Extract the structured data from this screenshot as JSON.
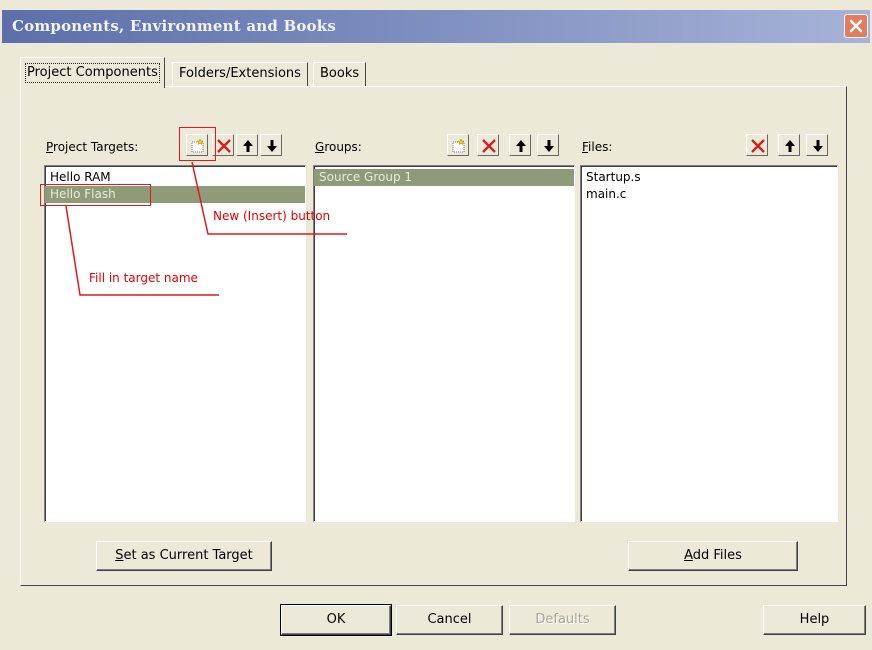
{
  "window": {
    "title": "Components, Environment and Books"
  },
  "tabs": [
    {
      "label": "Project Components",
      "active": true
    },
    {
      "label": "Folders/Extensions",
      "active": false
    },
    {
      "label": "Books",
      "active": false
    }
  ],
  "targets": {
    "label_prefix": "P",
    "label_rest": "roject Targets:",
    "items": [
      "Hello RAM",
      "Hello Flash"
    ],
    "selected": "Hello Flash",
    "buttons": [
      "new-icon",
      "delete-icon",
      "move-up-icon",
      "move-down-icon"
    ]
  },
  "groups": {
    "label_prefix": "G",
    "label_rest": "roups:",
    "items": [
      "Source Group 1"
    ],
    "selected": "Source Group 1",
    "buttons": [
      "new-icon",
      "delete-icon",
      "move-up-icon",
      "move-down-icon"
    ]
  },
  "files": {
    "label_prefix": "F",
    "label_rest": "iles:",
    "items": [
      "Startup.s",
      "main.c"
    ],
    "buttons": [
      "delete-icon",
      "move-up-icon",
      "move-down-icon"
    ]
  },
  "actions": {
    "set_target_prefix": "S",
    "set_target_rest": "et as Current Target",
    "add_files_prefix": "A",
    "add_files_rest": "dd Files"
  },
  "footer": {
    "ok": "OK",
    "cancel": "Cancel",
    "defaults": "Defaults",
    "help": "Help"
  },
  "annotations": {
    "new_button": "New (Insert) button",
    "fill_target": "Fill in target name",
    "color": "#e60000"
  },
  "colors": {
    "dialog_bg": "#ece9d8",
    "selection": "#8e9a78",
    "delete_x": "#d42020"
  }
}
